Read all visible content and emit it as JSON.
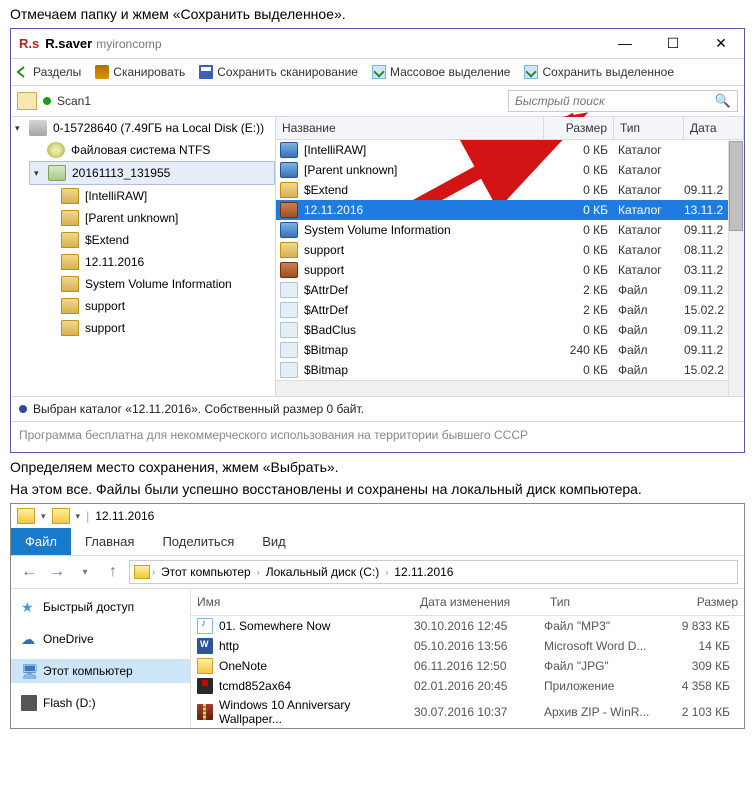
{
  "article": {
    "line1": "Отмечаем папку и жмем «Сохранить выделенное».",
    "line2": "Определяем место сохранения, жмем «Выбрать».",
    "line3": "На этом все. Файлы были успешно восстановлены и сохранены на локальный диск компьютера."
  },
  "rsaver": {
    "logo": "R.s",
    "title": "R.saver",
    "subtitle": "myironcomp",
    "toolbar": {
      "sections": "Разделы",
      "scan": "Сканировать",
      "save_scan": "Сохранить сканирование",
      "mass_select": "Массовое выделение",
      "save_selected": "Сохранить выделенное"
    },
    "nav": {
      "path": "Scan1",
      "search_placeholder": "Быстрый поиск"
    },
    "tree": {
      "root": "0-15728640 (7.49ГБ на Local Disk (E:))",
      "ntfs": "Файловая система NTFS",
      "folder": "20161113_131955",
      "children": [
        "[IntelliRAW]",
        "[Parent unknown]",
        "$Extend",
        "12.11.2016",
        "System Volume Information",
        "support",
        "support"
      ]
    },
    "list": {
      "headers": {
        "name": "Название",
        "size": "Размер",
        "type": "Тип",
        "date": "Дата"
      },
      "rows": [
        {
          "icon": "folder-open",
          "name": "[IntelliRAW]",
          "size": "0 КБ",
          "type": "Каталог",
          "date": ""
        },
        {
          "icon": "folder-open",
          "name": "[Parent unknown]",
          "size": "0 КБ",
          "type": "Каталог",
          "date": ""
        },
        {
          "icon": "folder",
          "name": "$Extend",
          "size": "0 КБ",
          "type": "Каталог",
          "date": "09.11.2"
        },
        {
          "icon": "folder-brown",
          "name": "12.11.2016",
          "size": "0 КБ",
          "type": "Каталог",
          "date": "13.11.2",
          "selected": true
        },
        {
          "icon": "folder-open",
          "name": "System Volume Information",
          "size": "0 КБ",
          "type": "Каталог",
          "date": "09.11.2"
        },
        {
          "icon": "folder",
          "name": "support",
          "size": "0 КБ",
          "type": "Каталог",
          "date": "08.11.2"
        },
        {
          "icon": "folder-brown",
          "name": "support",
          "size": "0 КБ",
          "type": "Каталог",
          "date": "03.11.2"
        },
        {
          "icon": "file",
          "name": "$AttrDef",
          "size": "2 КБ",
          "type": "Файл",
          "date": "09.11.2"
        },
        {
          "icon": "file",
          "name": "$AttrDef",
          "size": "2 КБ",
          "type": "Файл",
          "date": "15.02.2"
        },
        {
          "icon": "file",
          "name": "$BadClus",
          "size": "0 КБ",
          "type": "Файл",
          "date": "09.11.2"
        },
        {
          "icon": "file",
          "name": "$Bitmap",
          "size": "240 КБ",
          "type": "Файл",
          "date": "09.11.2"
        },
        {
          "icon": "file",
          "name": "$Bitmap",
          "size": "0 КБ",
          "type": "Файл",
          "date": "15.02.2"
        }
      ]
    },
    "status": "Выбран каталог «12.11.2016». Собственный размер 0 байт.",
    "footnote": "Программа бесплатна для некоммерческого использования на территории бывшего СССР"
  },
  "explorer": {
    "title": "12.11.2016",
    "tabs": {
      "file": "Файл",
      "home": "Главная",
      "share": "Поделиться",
      "view": "Вид"
    },
    "breadcrumb": [
      "Этот компьютер",
      "Локальный диск (C:)",
      "12.11.2016"
    ],
    "sidebar": {
      "quick": "Быстрый доступ",
      "onedrive": "OneDrive",
      "thispc": "Этот компьютер",
      "flash": "Flash (D:)"
    },
    "headers": {
      "name": "Имя",
      "date": "Дата изменения",
      "type": "Тип",
      "size": "Размер"
    },
    "rows": [
      {
        "icon": "mp3",
        "name": "01. Somewhere Now",
        "date": "30.10.2016 12:45",
        "type": "Файл \"MP3\"",
        "size": "9 833 КБ"
      },
      {
        "icon": "word",
        "name": "http",
        "date": "05.10.2016 13:56",
        "type": "Microsoft Word D...",
        "size": "14 КБ"
      },
      {
        "icon": "folder",
        "name": "OneNote",
        "date": "06.11.2016 12:50",
        "type": "Файл \"JPG\"",
        "size": "309 КБ"
      },
      {
        "icon": "disk",
        "name": "tcmd852ax64",
        "date": "02.01.2016 20:45",
        "type": "Приложение",
        "size": "4 358 КБ"
      },
      {
        "icon": "zip",
        "name": "Windows 10 Anniversary Wallpaper...",
        "date": "30.07.2016 10:37",
        "type": "Архив ZIP - WinR...",
        "size": "2 103 КБ"
      }
    ]
  }
}
